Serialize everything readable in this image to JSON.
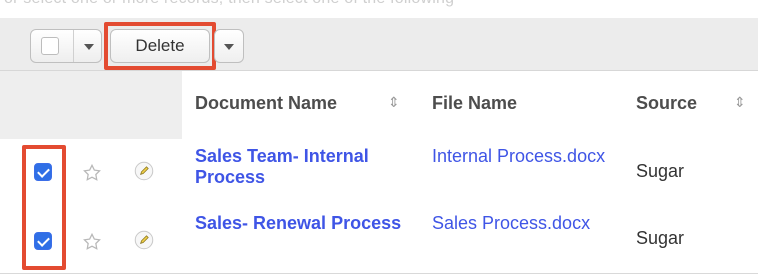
{
  "top_partial_text": "or select one or more records, then select one of the following",
  "toolbar": {
    "delete_label": "Delete"
  },
  "table": {
    "columns": [
      "Document Name",
      "File Name",
      "Source"
    ],
    "rows": [
      {
        "document_name": "Sales Team- Internal Process",
        "file_name": "Internal Process.docx",
        "source": "Sugar"
      },
      {
        "document_name": "Sales- Renewal Process",
        "file_name": "Sales Process.docx",
        "source": "Sugar"
      }
    ]
  },
  "colors": {
    "highlight": "#e34b31",
    "link": "#3f55e6",
    "checkbox": "#2f6fe6"
  },
  "icons": {
    "sort": "sort-icon",
    "favorite": "star-icon",
    "edit": "pencil-icon",
    "dropdown": "chevron-down-icon",
    "checked": "check-icon"
  }
}
